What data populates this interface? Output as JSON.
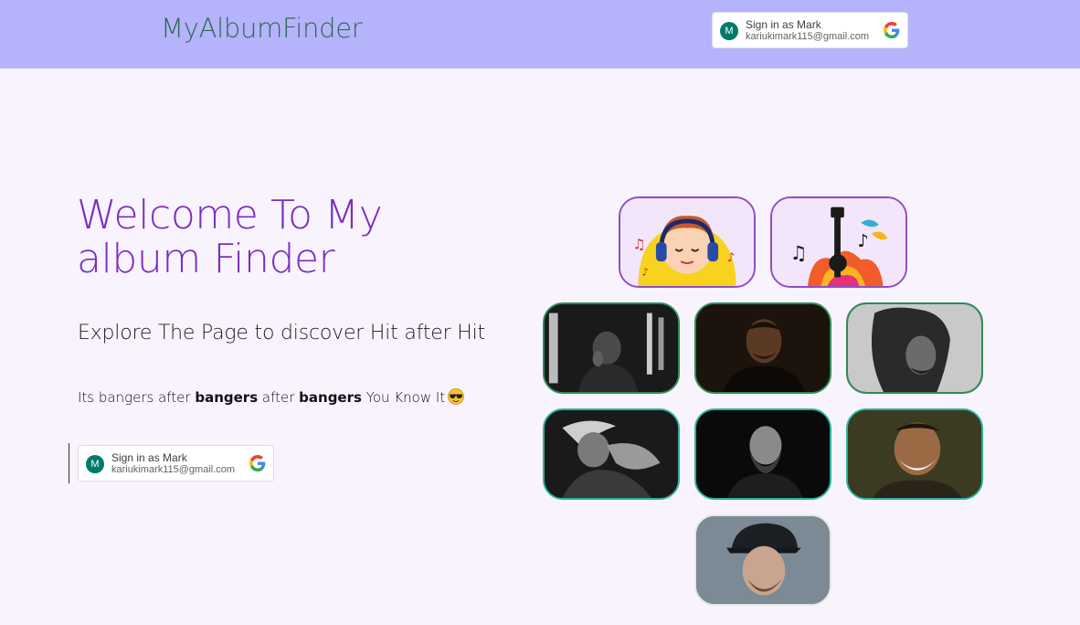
{
  "header": {
    "logo": "MyAlbumFinder"
  },
  "google_signin": {
    "avatar_letter": "M",
    "label": "Sign in as Mark",
    "email": "kariukimark115@gmail.com"
  },
  "hero": {
    "title": "Welcome To My album Finder",
    "subtitle": "Explore The Page to discover Hit after Hit",
    "tagline": {
      "part1": "Its bangers after ",
      "bold1": "bangers",
      "part2": " after ",
      "bold2": "bangers",
      "part3": " You Know It"
    }
  },
  "gallery": {
    "tiles": [
      {
        "name": "boy-headphones-illustration",
        "kind": "illustration"
      },
      {
        "name": "guitar-music-illustration",
        "kind": "illustration"
      },
      {
        "name": "artist-photo-1",
        "kind": "photo"
      },
      {
        "name": "artist-photo-2",
        "kind": "photo"
      },
      {
        "name": "artist-photo-3",
        "kind": "photo"
      },
      {
        "name": "artist-photo-4",
        "kind": "photo"
      },
      {
        "name": "artist-photo-5",
        "kind": "photo"
      },
      {
        "name": "artist-photo-6",
        "kind": "photo"
      },
      {
        "name": "artist-photo-7",
        "kind": "photo"
      }
    ]
  },
  "colors": {
    "header_bg": "#b6b3fd",
    "page_bg": "#f8f3fd",
    "logo": "#2d6b4f",
    "title": "#7b2cbf",
    "avatar": "#00796b"
  },
  "icons": [
    "google-logo-icon",
    "sunglasses-emoji-icon"
  ]
}
